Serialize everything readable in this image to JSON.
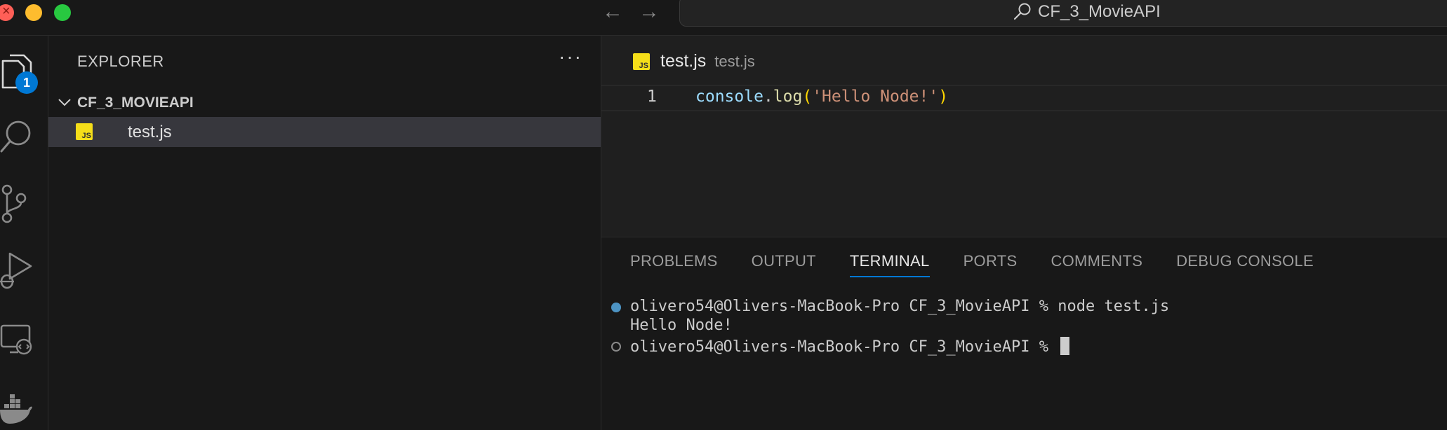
{
  "window": {
    "title": "CF_3_MovieAPI"
  },
  "activity_bar": {
    "icons": [
      "files-icon",
      "search-icon",
      "source-control-icon",
      "run-debug-icon",
      "remote-explorer-icon",
      "docker-icon"
    ],
    "explorer_badge": "1",
    "badge_color": "#0078d4"
  },
  "explorer": {
    "title": "EXPLORER",
    "more_label": "···",
    "folder": "CF_3_MOVIEAPI",
    "files": [
      {
        "name": "test.js",
        "icon_text": "JS",
        "selected": true
      }
    ]
  },
  "editor": {
    "breadcrumb_file": "test.js",
    "breadcrumb_path": "test.js",
    "lines": [
      {
        "number": "1",
        "tokens": {
          "obj": "console",
          "dot": ".",
          "fn": "log",
          "open": "(",
          "str": "'Hello Node!'",
          "close": ")"
        }
      }
    ]
  },
  "panel": {
    "tabs": [
      "PROBLEMS",
      "OUTPUT",
      "TERMINAL",
      "PORTS",
      "COMMENTS",
      "DEBUG CONSOLE"
    ],
    "active_tab": "TERMINAL",
    "terminal": {
      "line1": "olivero54@Olivers-MacBook-Pro CF_3_MovieAPI % node test.js",
      "line2": "Hello Node!",
      "line3": "olivero54@Olivers-MacBook-Pro CF_3_MovieAPI % "
    }
  },
  "colors": {
    "accent": "#0078d4",
    "js_icon": "#f5de19",
    "string": "#ce9178",
    "function": "#dcdcaa",
    "variable": "#9cdcfe"
  }
}
